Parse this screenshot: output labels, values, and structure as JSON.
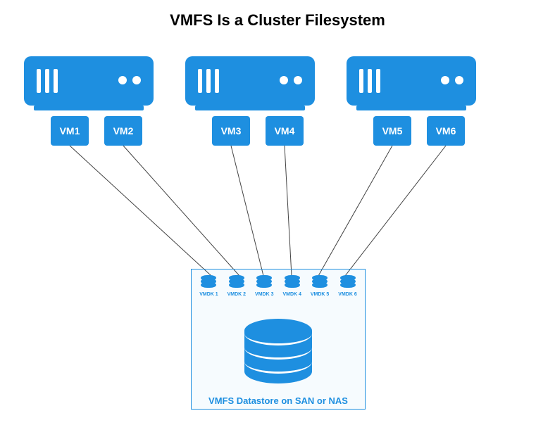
{
  "title": "VMFS Is a Cluster Filesystem",
  "hosts": [
    {
      "vms": [
        "VM1",
        "VM2"
      ]
    },
    {
      "vms": [
        "VM3",
        "VM4"
      ]
    },
    {
      "vms": [
        "VM5",
        "VM6"
      ]
    }
  ],
  "vmdks": [
    "VMDK 1",
    "VMDK 2",
    "VMDK 3",
    "VMDK 4",
    "VMDK 5",
    "VMDK 6"
  ],
  "datastore_label": "VMFS Datastore on SAN or NAS",
  "colors": {
    "accent": "#1e8fe0"
  }
}
